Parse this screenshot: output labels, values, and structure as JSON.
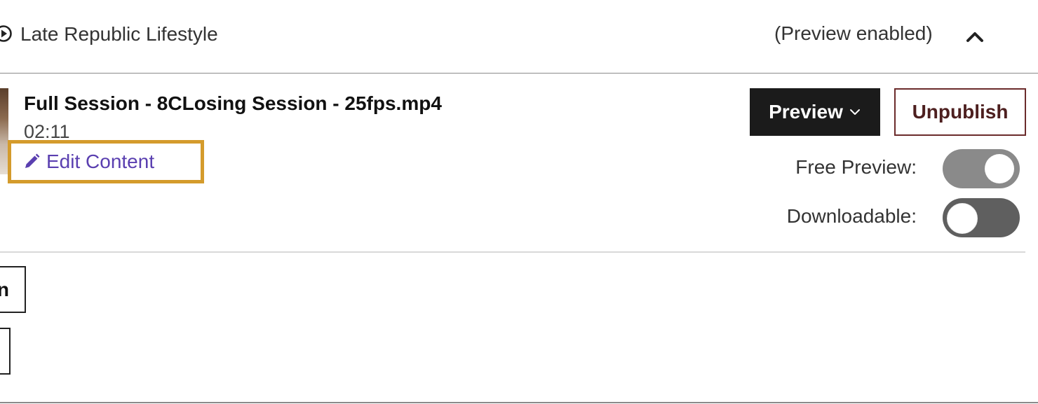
{
  "section": {
    "icon": "play-circle-icon",
    "title": "Late Republic Lifestyle",
    "status": "(Preview enabled)",
    "collapse_icon": "chevron-up-icon"
  },
  "item": {
    "thumbnail_icon": "video-thumbnail",
    "file_name": "Full Session - 8CLosing Session - 25fps.mp4",
    "duration": "02:11",
    "edit_label": "Edit Content",
    "edit_icon": "pencil-icon",
    "highlight_color": "#d49b2c",
    "link_color": "#5a3fb0"
  },
  "actions": {
    "preview_label": "Preview",
    "preview_icon": "chevron-down-icon",
    "unpublish_label": "Unpublish"
  },
  "toggles": {
    "free_preview_label": "Free Preview:",
    "free_preview_on": true,
    "downloadable_label": "Downloadable:",
    "downloadable_on": false
  },
  "partial_buttons": {
    "first_label": "n"
  }
}
